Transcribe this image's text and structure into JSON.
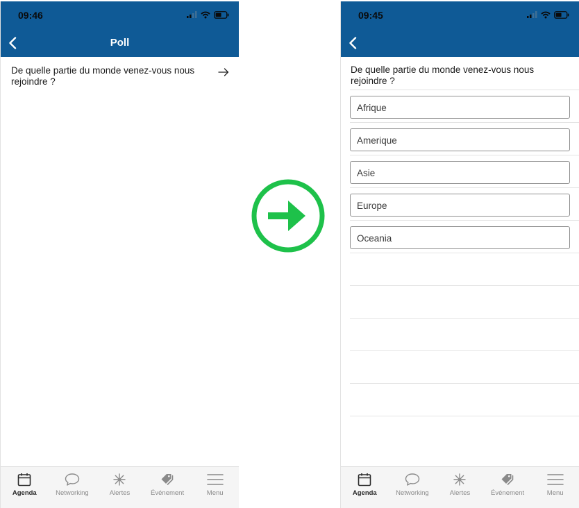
{
  "colors": {
    "header_bg": "#0f5a96",
    "accent_arrow": "#1ec14a",
    "tab_active": "#2a2a2a",
    "tab_inactive": "#8a8a8a"
  },
  "left_screen": {
    "status": {
      "time": "09:46"
    },
    "title": "Poll",
    "question": "De quelle partie du monde venez-vous nous rejoindre ?"
  },
  "right_screen": {
    "status": {
      "time": "09:45"
    },
    "question": "De quelle partie du monde venez-vous nous rejoindre ?",
    "options": [
      "Afrique",
      "Amerique",
      "Asie",
      "Europe",
      "Oceania"
    ]
  },
  "tabbar": {
    "items": [
      {
        "label": "Agenda",
        "icon": "calendar-icon",
        "active": true
      },
      {
        "label": "Networking",
        "icon": "chat-bubble-icon",
        "active": false
      },
      {
        "label": "Alertes",
        "icon": "asterisk-icon",
        "active": false
      },
      {
        "label": "Événement",
        "icon": "tags-icon",
        "active": false
      },
      {
        "label": "Menu",
        "icon": "hamburger-menu-icon",
        "active": false
      }
    ]
  }
}
